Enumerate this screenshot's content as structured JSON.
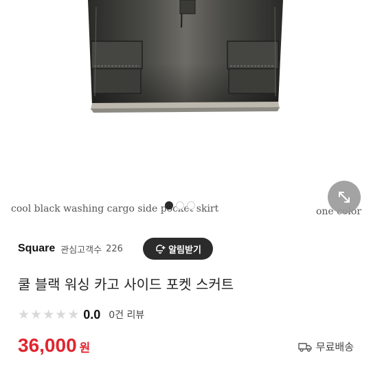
{
  "product_image": {
    "caption_left": "cool black washing cargo side pocket skirt",
    "caption_right": "one color",
    "carousel": {
      "total": 3,
      "active_index": 1
    }
  },
  "shop": {
    "name": "Square",
    "follower_label": "관심고객수",
    "follower_count": "226",
    "alert_button_label": "알림받기"
  },
  "product": {
    "title": "쿨 블랙 워싱 카고 사이드 포켓 스커트",
    "rating": {
      "stars_filled": 0,
      "stars_total": 5,
      "value": "0.0",
      "review_count_label": "0건 리뷰"
    },
    "price": "36,000",
    "currency": "원",
    "shipping_label": "무료배송"
  },
  "colors": {
    "price_red": "#e0262f",
    "alert_button_bg": "#2b2b2b",
    "star_empty": "#d9d9d9"
  },
  "icons": [
    "expand-icon",
    "bell-plus-icon",
    "star-icon",
    "delivery-truck-icon"
  ]
}
